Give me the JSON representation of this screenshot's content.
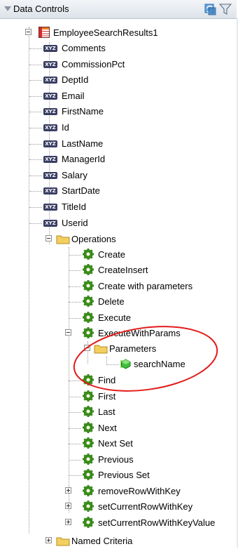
{
  "panel": {
    "title": "Data Controls"
  },
  "collection": {
    "name": "EmployeeSearchResults1"
  },
  "attributes": [
    {
      "label": "Comments"
    },
    {
      "label": "CommissionPct"
    },
    {
      "label": "DeptId"
    },
    {
      "label": "Email"
    },
    {
      "label": "FirstName"
    },
    {
      "label": "Id"
    },
    {
      "label": "LastName"
    },
    {
      "label": "ManagerId"
    },
    {
      "label": "Salary"
    },
    {
      "label": "StartDate"
    },
    {
      "label": "TitleId"
    },
    {
      "label": "Userid"
    }
  ],
  "operations": {
    "label": "Operations",
    "items": [
      {
        "label": "Create"
      },
      {
        "label": "CreateInsert"
      },
      {
        "label": "Create with parameters"
      },
      {
        "label": "Delete"
      },
      {
        "label": "Execute"
      },
      {
        "label": "ExecuteWithParams"
      },
      {
        "label": "Find"
      },
      {
        "label": "First"
      },
      {
        "label": "Last"
      },
      {
        "label": "Next"
      },
      {
        "label": "Next Set"
      },
      {
        "label": "Previous"
      },
      {
        "label": "Previous Set"
      },
      {
        "label": "removeRowWithKey"
      },
      {
        "label": "setCurrentRowWithKey"
      },
      {
        "label": "setCurrentRowWithKeyValue"
      }
    ],
    "parameters": {
      "label": "Parameters",
      "items": [
        {
          "label": "searchName"
        }
      ]
    }
  },
  "named_criteria": {
    "label": "Named Criteria"
  },
  "colors": {
    "highlight_ellipse": "#e21b1b",
    "gear": "#3a8e1a",
    "folder": "#f3cf5f",
    "xyz_badge": "#3a3d63"
  }
}
